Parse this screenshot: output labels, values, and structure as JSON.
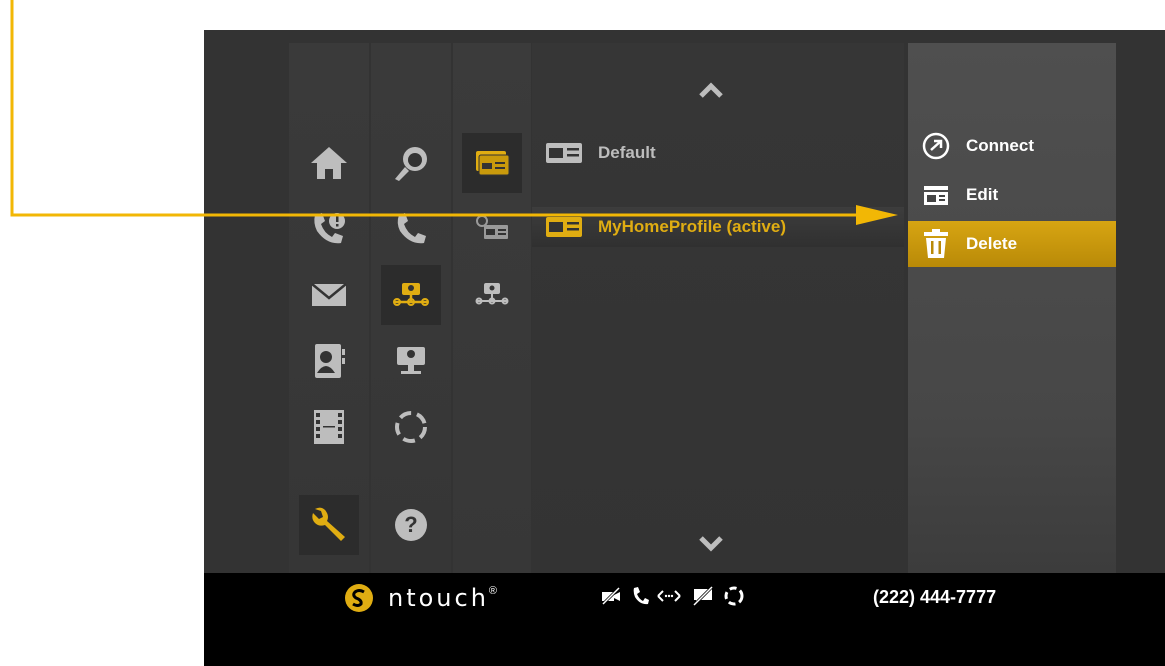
{
  "colors": {
    "accent": "#e0ad12",
    "icon_gray": "#bdbdbd",
    "bar_bg": "#000000",
    "callout_line": "#f2b705"
  },
  "left_nav": {
    "col1": [
      "home-icon",
      "missed-calls-icon",
      "mail-icon",
      "contacts-icon",
      "video-center-icon",
      "settings-wrench-icon"
    ],
    "col2": [
      "personal-settings-icon",
      "call-settings-icon",
      "network-settings-icon",
      "video-settings-icon",
      "sync-icon",
      "help-icon"
    ],
    "col3": [
      "profiles-icon",
      "profile-add-icon",
      "network-profile-icon"
    ]
  },
  "profiles": {
    "items": [
      {
        "label": "Default",
        "active": false
      },
      {
        "label": "MyHomeProfile (active)",
        "active": true
      }
    ]
  },
  "context_menu": {
    "items": [
      {
        "label": "Connect",
        "icon": "connect-icon"
      },
      {
        "label": "Edit",
        "icon": "edit-icon"
      },
      {
        "label": "Delete",
        "icon": "trash-icon",
        "highlighted": true
      }
    ]
  },
  "status_bar": {
    "brand": "ntouch",
    "brand_mark": "®",
    "phone": "(222) 444-7777",
    "icons": [
      "video-off-icon",
      "phone-icon",
      "network-arrows-icon",
      "no-chat-icon",
      "sync-status-icon"
    ]
  }
}
